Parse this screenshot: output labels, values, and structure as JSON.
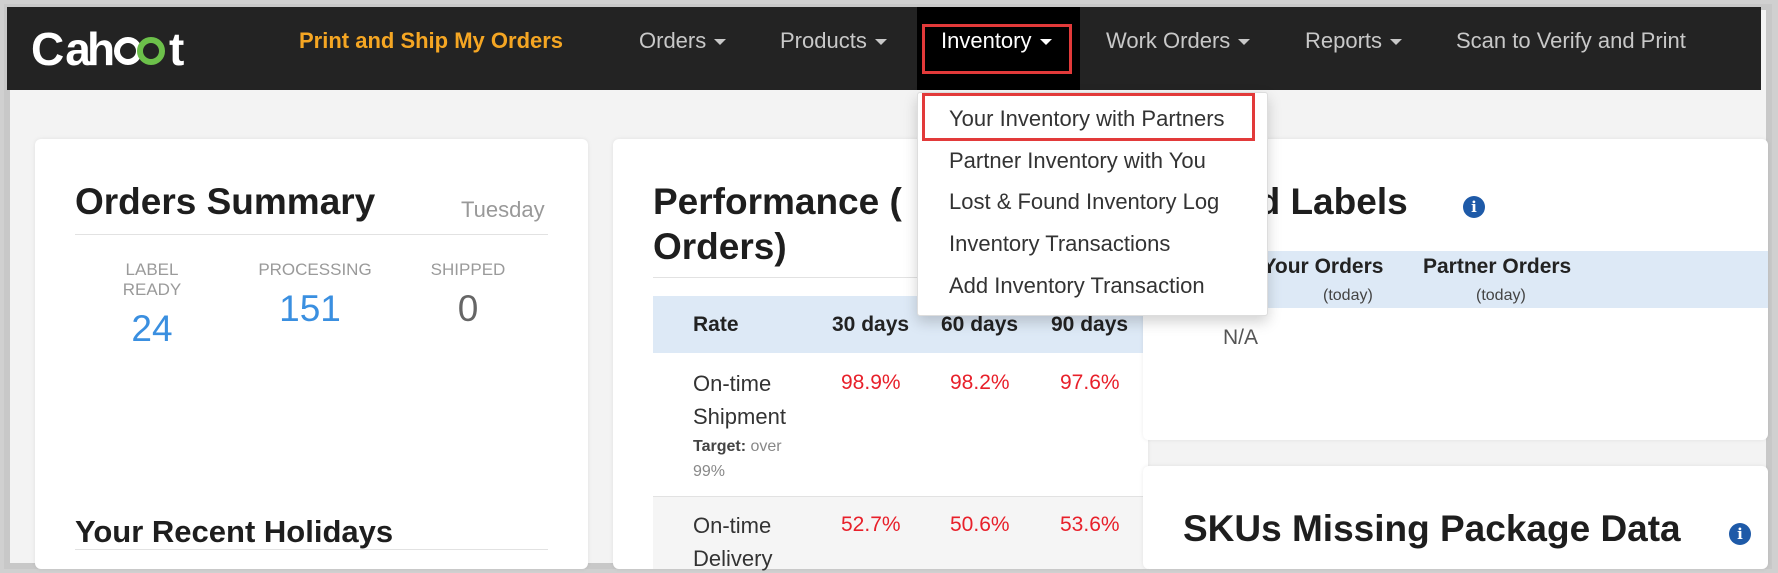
{
  "nav": {
    "logo": "Cahoot",
    "brand_link": "Print and Ship My Orders",
    "items": [
      "Orders",
      "Products",
      "Inventory",
      "Work Orders",
      "Reports"
    ],
    "scan_link": "Scan to Verify and Print"
  },
  "dropdown": {
    "items": [
      "Your Inventory with Partners",
      "Partner Inventory with You",
      "Lost & Found Inventory Log",
      "Inventory Transactions",
      "Add Inventory Transaction"
    ]
  },
  "orders_summary": {
    "title": "Orders Summary",
    "day": "Tuesday",
    "stats": [
      {
        "label_line1": "LABEL",
        "label_line2": "READY",
        "value": "24"
      },
      {
        "label_line1": "PROCESSING",
        "label_line2": "",
        "value": "151"
      },
      {
        "label_line1": "SHIPPED",
        "label_line2": "",
        "value": "0"
      }
    ],
    "holidays_title": "Your Recent Holidays"
  },
  "performance": {
    "title_line1": "Performance (",
    "title_line2": "Orders)",
    "headers": [
      "Rate",
      "30 days",
      "60 days",
      "90 days"
    ],
    "rows": [
      {
        "name_line1": "On-time",
        "name_line2": "Shipment",
        "target_label": "Target:",
        "target_value_line1": "over",
        "target_value_line2": "99%",
        "values": [
          "98.9%",
          "98.2%",
          "97.6%"
        ]
      },
      {
        "name_line1": "On-time",
        "name_line2": "Delivery",
        "values": [
          "52.7%",
          "50.6%",
          "53.6%"
        ]
      }
    ]
  },
  "labels": {
    "title": "ed Labels",
    "col1": "or Your Orders",
    "col2": "Partner Orders",
    "col1_sub": "(today)",
    "col2_sub": "(today)",
    "value": "N/A"
  },
  "skus": {
    "title": "SKUs Missing Package Data"
  },
  "colors": {
    "brand": "#f5a623",
    "link_blue": "#3a8fe0",
    "red": "#e8202a",
    "highlight": "#e23a3a"
  }
}
